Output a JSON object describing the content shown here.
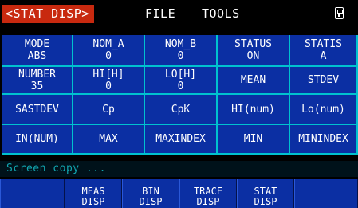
{
  "top_bar": {
    "page_title": "<STAT DISP>",
    "menu_file": "FILE",
    "menu_tools": "TOOLS"
  },
  "grid": {
    "rows": [
      [
        {
          "label": "MODE",
          "value": "ABS"
        },
        {
          "label": "NOM_A",
          "value": "0"
        },
        {
          "label": "NOM_B",
          "value": "0"
        },
        {
          "label": "STATUS",
          "value": "ON"
        },
        {
          "label": "STATIS",
          "value": "A"
        }
      ],
      [
        {
          "label": "NUMBER",
          "value": "35"
        },
        {
          "label": "HI[H]",
          "value": "0"
        },
        {
          "label": "LO[H]",
          "value": "0"
        },
        {
          "label": "MEAN",
          "value": ""
        },
        {
          "label": "STDEV",
          "value": ""
        }
      ],
      [
        {
          "label": "SASTDEV",
          "value": ""
        },
        {
          "label": "Cp",
          "value": ""
        },
        {
          "label": "CpK",
          "value": ""
        },
        {
          "label": "HI(num)",
          "value": ""
        },
        {
          "label": "Lo(num)",
          "value": ""
        }
      ],
      [
        {
          "label": "IN(NUM)",
          "value": ""
        },
        {
          "label": "MAX",
          "value": ""
        },
        {
          "label": "MAXINDEX",
          "value": ""
        },
        {
          "label": "MIN",
          "value": ""
        },
        {
          "label": "MININDEX",
          "value": ""
        }
      ]
    ]
  },
  "status_line": "Screen copy ...",
  "softkeys": [
    {
      "line1": "",
      "line2": ""
    },
    {
      "line1": "MEAS",
      "line2": "DISP"
    },
    {
      "line1": "BIN",
      "line2": "DISP"
    },
    {
      "line1": "TRACE",
      "line2": "DISP"
    },
    {
      "line1": "STAT",
      "line2": "DISP"
    },
    {
      "line1": "",
      "line2": ""
    }
  ],
  "colors": {
    "title_tab": "#c8290f",
    "cell_bg": "#0b2fa3",
    "grid_lines": "#00c2cf",
    "status_text": "#11a6b0"
  }
}
